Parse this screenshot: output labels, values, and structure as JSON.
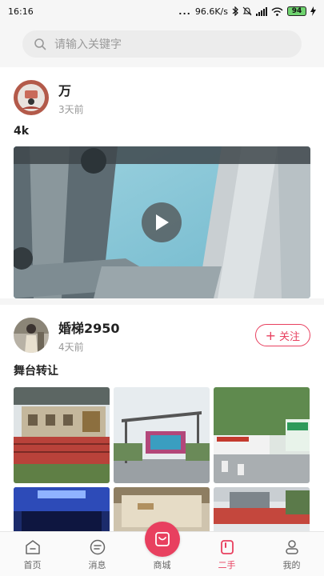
{
  "status_bar": {
    "time": "16:16",
    "dots": "...",
    "network_speed": "96.6K/s",
    "battery": "94"
  },
  "search": {
    "placeholder": "请输入关键字",
    "icon": "search-icon"
  },
  "posts": [
    {
      "author": "万",
      "time": "3天前",
      "text": "4k",
      "media": "video"
    },
    {
      "author": "婚梯2950",
      "time": "4天前",
      "follow_label": "关注",
      "text": "舞台转让",
      "media": "photos"
    }
  ],
  "bottom_nav": [
    {
      "label": "首页",
      "icon": "home-icon"
    },
    {
      "label": "消息",
      "icon": "message-icon"
    },
    {
      "label": "商城",
      "icon": "shop-icon"
    },
    {
      "label": "二手",
      "icon": "secondhand-icon",
      "active": true
    },
    {
      "label": "我的",
      "icon": "profile-icon"
    }
  ],
  "colors": {
    "accent": "#e8405f",
    "background": "#f5f5f5"
  }
}
